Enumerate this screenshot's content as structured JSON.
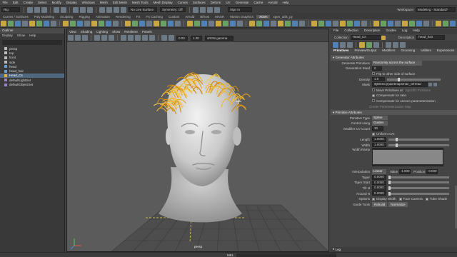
{
  "menu": [
    "File",
    "Edit",
    "Create",
    "Select",
    "Modify",
    "Display",
    "Windows",
    "Mesh",
    "Edit Mesh",
    "Mesh Tools",
    "Mesh Display",
    "Curves",
    "Surfaces",
    "Deform",
    "UV",
    "Generate",
    "Cache",
    "Arnold",
    "Help"
  ],
  "workspace_label": "Workspace:",
  "workspace_value": "Modeling - Standard*",
  "mode_value": "Rig",
  "live_surface": "No Live Surface",
  "symmetry": "Symmetry: Off",
  "sign_in": "Sign In",
  "shelf_tabs": [
    "Curves / Surfaces",
    "Poly Modeling",
    "Sculpting",
    "Rigging",
    "Animation",
    "Rendering",
    "FX",
    "FX Caching",
    "Custom",
    "Arnold",
    "Bifrost",
    "MASH",
    "Motion Graphics",
    "XGen",
    "xgen_utils_py"
  ],
  "shelf_active": "XGen",
  "outliner": {
    "title": "Outliner",
    "menu": [
      "Display",
      "Show",
      "Help"
    ],
    "items": [
      {
        "label": "persp",
        "icon": "camera-icon"
      },
      {
        "label": "top",
        "icon": "camera-icon"
      },
      {
        "label": "front",
        "icon": "camera-icon"
      },
      {
        "label": "side",
        "icon": "camera-icon"
      },
      {
        "label": "head",
        "icon": "mesh-icon"
      },
      {
        "label": "head_hair",
        "icon": "mesh-icon"
      },
      {
        "label": "Head_Cs",
        "icon": "collection-icon"
      },
      {
        "label": "defaultLightSet",
        "icon": "set-icon"
      },
      {
        "label": "defaultObjectSet",
        "icon": "set-icon"
      }
    ],
    "selected_index": 6
  },
  "viewport": {
    "menu": [
      "View",
      "Shading",
      "Lighting",
      "Show",
      "Renderer",
      "Panels"
    ],
    "near": "0.00",
    "far": "1.00",
    "color_space": "sRGB gamma",
    "camera_label": "persp",
    "hair_color": "#e8a21c",
    "head_color": "#d4d4d4",
    "bg_color": "#5b5b5b"
  },
  "ae": {
    "menu": [
      "File",
      "Collection",
      "Description",
      "Guides",
      "Log",
      "Help"
    ],
    "collection_label": "Collection",
    "collection_value": "Head_Cs",
    "description_label": "Description",
    "description_value": "head_hair",
    "tabs": [
      "Primitives",
      "Preview/Output",
      "Modifiers",
      "Grooming",
      "Utilities",
      "Expressions"
    ],
    "gen_section": "Generator Attributes",
    "gen_primitives_label": "Generate Primitives",
    "gen_primitives_value": "Randomly across the surface",
    "gen_seed_label": "Generation Seed",
    "gen_seed_value": "0",
    "flip_label": "Flip to other side of surface",
    "density_label": "Density",
    "density_value": "1.0",
    "mask_label": "Mask",
    "mask_value": "${DESC}/paintmaps/hair_0/Head",
    "move_preview": "Move Primitives at",
    "move_preview_value": "Specific Positions",
    "compensate_scale": "Compensate for ratio",
    "compensate_param": "Compensate for uneven parameterization",
    "create_map": "Create Parameterization Map",
    "prim_section": "Primitive Attributes",
    "prim_type_label": "Primitive Type",
    "prim_type_value": "Spline",
    "control_label": "Control using",
    "control_value": "Guides",
    "cv_count_label": "Modifier CV Count",
    "cv_count_value": "30",
    "uniform_cvs": "Uniform CVs",
    "length_label": "Length",
    "length_value": "1.0000",
    "width_label": "Width",
    "width_value": "1.0000",
    "width_ramp_label": "Width Ramp",
    "interp_label": "Interpolation",
    "interp_value": "Linear",
    "value_label": "Value",
    "value_value": "1.000",
    "position_label": "Position",
    "position_value": "0.000",
    "taper_label": "Taper",
    "taper_value": "0.0000",
    "taper_start_label": "Taper Start",
    "taper_start_value": "0.0000",
    "tilt_label": "Tilt N",
    "tilt_value": "0.0000",
    "around_label": "Around N",
    "around_value": "0.0000",
    "options_label": "Options",
    "display_width": "Display Width",
    "face_camera": "Face Camera",
    "tube_shade": "Tube Shade",
    "guide_tools_label": "Guide Tools",
    "rebuild_btn": "Rebuild",
    "normalize_btn": "Normalize",
    "log_label": "Log"
  },
  "bottom_label": "MEL"
}
